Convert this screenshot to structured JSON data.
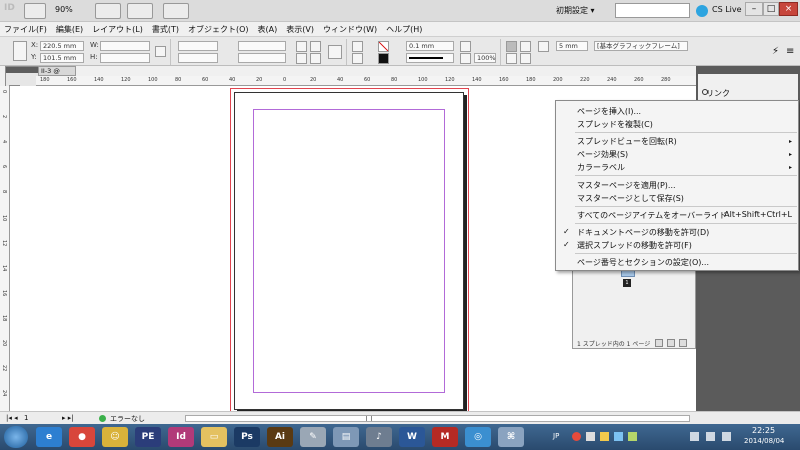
{
  "titlebar": {
    "zoom": "90%",
    "workspace": "初期設定 ▾",
    "cs_live": "CS Live",
    "min_label": "–",
    "max_label": "□",
    "close_label": "×"
  },
  "menubar": {
    "items": [
      "ファイル(F)",
      "編集(E)",
      "レイアウト(L)",
      "書式(T)",
      "オブジェクト(O)",
      "表(A)",
      "表示(V)",
      "ウィンドウ(W)",
      "ヘルプ(H)"
    ]
  },
  "control": {
    "x_label": "X:",
    "y_label": "Y:",
    "w_label": "W:",
    "h_label": "H:",
    "x_value": "220.5 mm",
    "y_value": "101.5 mm",
    "stroke_weight": "0.1 mm",
    "scale": "100%",
    "offset": "5 mm",
    "frame_style": "[基本グラフィックフレーム]"
  },
  "doc": {
    "tab_label": "II-3 @ 90%"
  },
  "ruler": {
    "top_numbers": [
      "180",
      "160",
      "140",
      "120",
      "100",
      "80",
      "60",
      "40",
      "20",
      "0",
      "20",
      "40",
      "60",
      "80",
      "100",
      "120",
      "140",
      "160",
      "180",
      "200",
      "220",
      "240",
      "260",
      "280"
    ],
    "left_numbers": [
      "0",
      "2",
      "4",
      "6",
      "8",
      "10",
      "12",
      "14",
      "16",
      "18",
      "20",
      "22",
      "24"
    ]
  },
  "dock": {
    "links_label": "リンク"
  },
  "pages_panel": {
    "page_number": "1",
    "status": "1 スプレッド内の 1 ページ"
  },
  "context_menu": {
    "items": [
      {
        "label": "ページを挿入(I)..."
      },
      {
        "label": "スプレッドを複製(C)"
      },
      {
        "label": "スプレッドビューを回転(R)",
        "submenu": true
      },
      {
        "label": "ページ効果(S)",
        "submenu": true
      },
      {
        "label": "カラーラベル",
        "submenu": true
      },
      {
        "label": "マスターページを適用(P)..."
      },
      {
        "label": "マスターページとして保存(S)"
      },
      {
        "label": "すべてのページアイテムをオーバーライド",
        "shortcut": "Alt+Shift+Ctrl+L"
      },
      {
        "label": "ドキュメントページの移動を許可(D)",
        "checked": true
      },
      {
        "label": "選択スプレッドの移動を許可(F)",
        "checked": true
      },
      {
        "label": "ページ番号とセクションの設定(O)..."
      }
    ],
    "check_glyph": "✓",
    "arrow_glyph": "▸"
  },
  "statusbar": {
    "page": "1",
    "preflight_status": "エラーなし"
  },
  "taskbar": {
    "apps": [
      {
        "name": "ie",
        "label": "e",
        "color": "#2d7fd1"
      },
      {
        "name": "chrome",
        "label": "●",
        "color": "#d8463b"
      },
      {
        "name": "smile",
        "label": "☺",
        "color": "#d9b23a"
      },
      {
        "name": "photoshop-elements",
        "label": "PE",
        "color": "#2b3d7a"
      },
      {
        "name": "indesign",
        "label": "Id",
        "color": "#b13a79"
      },
      {
        "name": "explorer",
        "label": "▭",
        "color": "#e4c160"
      },
      {
        "name": "photoshop",
        "label": "Ps",
        "color": "#1b3a64"
      },
      {
        "name": "illustrator",
        "label": "Ai",
        "color": "#5a3a13"
      },
      {
        "name": "tool-1",
        "label": "✎",
        "color": "#9aa7b5"
      },
      {
        "name": "tool-2",
        "label": "▤",
        "color": "#7e98b6"
      },
      {
        "name": "microphone",
        "label": "♪",
        "color": "#6e7d90"
      },
      {
        "name": "word",
        "label": "W",
        "color": "#2b5797"
      },
      {
        "name": "mcafee",
        "label": "M",
        "color": "#b52a24"
      },
      {
        "name": "browser",
        "label": "◎",
        "color": "#3b8fd0"
      },
      {
        "name": "network",
        "label": "⌘",
        "color": "#8aa3c0"
      }
    ],
    "lang": "JP",
    "time": "22:25",
    "date": "2014/08/04"
  }
}
